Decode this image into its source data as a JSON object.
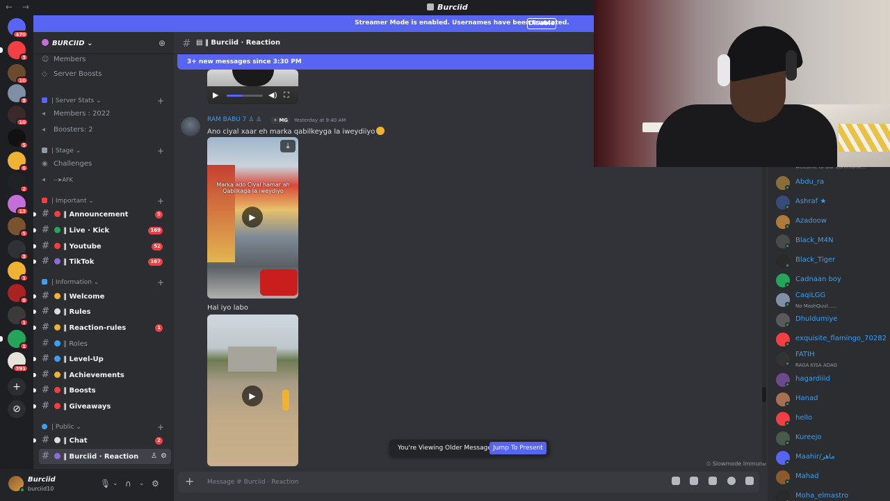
{
  "titlebar": {
    "title": "Burciid",
    "back": "←",
    "forward": "→"
  },
  "banner": {
    "text": "Streamer Mode is enabled. Usernames have been truncated.",
    "button": "Disable"
  },
  "servers": [
    {
      "color": "#5865f2",
      "badge": "470"
    },
    {
      "color": "#f23f43",
      "badge": "3"
    },
    {
      "color": "#6b4a2e",
      "badge": "10"
    },
    {
      "color": "#7f8fa6",
      "badge": "8"
    },
    {
      "color": "#3b2a2a",
      "badge": "10"
    },
    {
      "color": "#111111",
      "badge": "5"
    },
    {
      "color": "#f0b232",
      "badge": "6"
    },
    {
      "color": "#202225",
      "badge": "2"
    },
    {
      "color": "#c46ed7",
      "badge": "13"
    },
    {
      "color": "#7a5230",
      "badge": "5"
    },
    {
      "color": "#2f3136",
      "badge": "3"
    },
    {
      "color": "#f0b232",
      "badge": "1"
    },
    {
      "color": "#aa2222",
      "badge": "8"
    },
    {
      "color": "#3a3a3a",
      "badge": "1"
    },
    {
      "color": "#23a55a",
      "badge": "1"
    },
    {
      "color": "#e7e2da",
      "badge": "391"
    }
  ],
  "server_name": "BURCIID",
  "sidebar_top": [
    {
      "label": "Members",
      "icon": "members-icon"
    },
    {
      "label": "Server Boosts",
      "icon": "boost-icon"
    }
  ],
  "categories": {
    "server_stats": "| Server Stats",
    "stage": "| Stage",
    "important": "| Important",
    "information": "| Information",
    "public": "| Public"
  },
  "stats": {
    "members": "Members : 2022",
    "boosters": "Boosters: 2"
  },
  "stage": {
    "challenges": "Challenges",
    "afk": "AFK"
  },
  "important": [
    {
      "label": "Announcement",
      "count": "5",
      "emo": "#f23f43"
    },
    {
      "label": "Live · Kick",
      "count": "169",
      "emo": "#23a55a"
    },
    {
      "label": "Youtube",
      "count": "52",
      "emo": "#f23f43"
    },
    {
      "label": "TikTok",
      "count": "167",
      "emo": "#8e6cd8"
    }
  ],
  "information": [
    {
      "label": "Welcome",
      "count": "",
      "emo": "#f0b232",
      "unread": true
    },
    {
      "label": "Rules",
      "count": "",
      "emo": "#dbdee1",
      "unread": true
    },
    {
      "label": "Reaction-rules",
      "count": "1",
      "emo": "#f0b232",
      "unread": true
    },
    {
      "label": "Roles",
      "count": "",
      "emo": "#3ba0f2",
      "unread": false
    },
    {
      "label": "Level-Up",
      "count": "",
      "emo": "#3ba0f2",
      "unread": true
    },
    {
      "label": "Achievements",
      "count": "",
      "emo": "#f0b232",
      "unread": true
    },
    {
      "label": "Boosts",
      "count": "",
      "emo": "#f23f43",
      "unread": true
    },
    {
      "label": "Giveaways",
      "count": "",
      "emo": "#f23f43",
      "unread": true
    }
  ],
  "public": [
    {
      "label": "Chat",
      "count": "2",
      "emo": "#dbdee1"
    },
    {
      "label": "Burciid · Reaction",
      "count": "",
      "emo": "#8e6cd8"
    }
  ],
  "user": {
    "name": "Burciid",
    "status": "burciid10"
  },
  "channel": {
    "name": "Burciid · Reaction",
    "new_messages": "3+ new messages since 3:30 PM"
  },
  "message": {
    "author": "RAM BABU 7",
    "tag": "MG",
    "timestamp": "Yesterday at 9:40 AM",
    "text": "Ano ciyal xaar eh marka qabilkeyga la iweydiiyo",
    "video_caption": "Marka ado Ciyal hamar ah Qabilkaga la iweydiyo",
    "second_text": "Hal iyo labo",
    "video_progress": 0.45
  },
  "viewing": {
    "text": "You're Viewing Older Messages",
    "button": "Jump To Present"
  },
  "slowmode": "Slowmode Immune",
  "composer": {
    "placeholder": "Message # Burciid · Reaction"
  },
  "member_header": "welcome to Our Communit...",
  "members": [
    {
      "name": "Abdu_ra",
      "sub": "",
      "color": "#8a6e3a"
    },
    {
      "name": "Ashraf ★",
      "sub": "",
      "color": "#3a4b7a"
    },
    {
      "name": "Azadoow",
      "sub": "",
      "color": "#b07a3a"
    },
    {
      "name": "Black_M4N",
      "sub": "",
      "color": "#4a4a4a"
    },
    {
      "name": "Black_Tiger",
      "sub": "",
      "color": "#2a2a2a"
    },
    {
      "name": "Cadnaan boy",
      "sub": "",
      "color": "#23a55a"
    },
    {
      "name": "CaqiLGG",
      "sub": "No MashQuul......",
      "color": "#7f8fa6"
    },
    {
      "name": "Dhuldumiye",
      "sub": "",
      "color": "#5a5a5a"
    },
    {
      "name": "exquisite_flamingo_70282",
      "sub": "",
      "color": "#f23f43"
    },
    {
      "name": "FATIH",
      "sub": "RAGA KISA ADAG",
      "color": "#333333"
    },
    {
      "name": "hagardiiid",
      "sub": "",
      "color": "#6a4a8a"
    },
    {
      "name": "Hanad",
      "sub": "",
      "color": "#a87050"
    },
    {
      "name": "hello",
      "sub": "",
      "color": "#f23f43"
    },
    {
      "name": "Kureejo",
      "sub": "",
      "color": "#4a5a4a"
    },
    {
      "name": "Maahir/ماهر",
      "sub": "",
      "color": "#5865f2"
    },
    {
      "name": "Mahad",
      "sub": "",
      "color": "#8a5a2b"
    },
    {
      "name": "Moha_elmastro",
      "sub": "",
      "color": "#2a2a2a"
    }
  ]
}
